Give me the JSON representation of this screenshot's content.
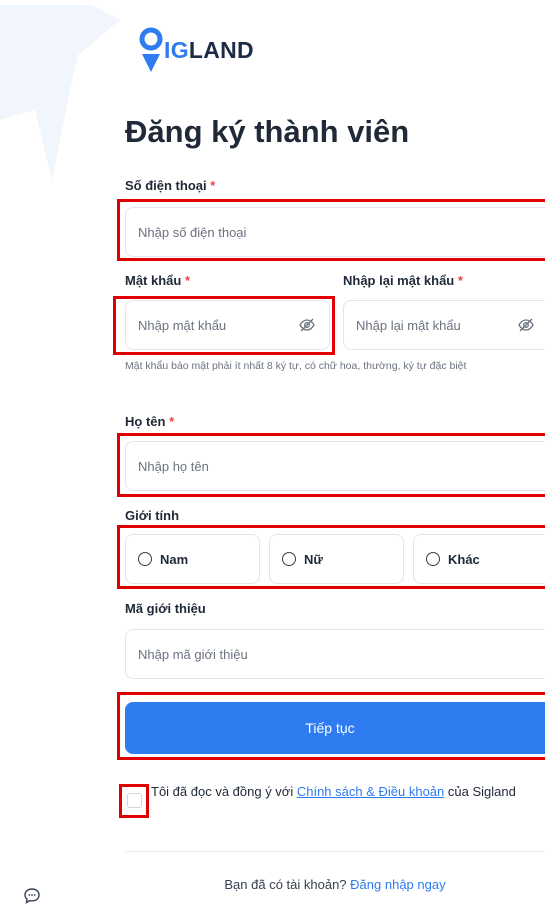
{
  "brand": {
    "logo_prefix": "IG",
    "logo_suffix": "LAND"
  },
  "page_title": "Đăng ký thành viên",
  "phone": {
    "label": "Số điện thoại",
    "required_mark": "*",
    "placeholder": "Nhập số điện thoại"
  },
  "password": {
    "label": "Mật khẩu",
    "required_mark": "*",
    "placeholder": "Nhập mật khẩu"
  },
  "confirm_password": {
    "label": "Nhập lại mật khẩu",
    "required_mark": "*",
    "placeholder": "Nhập lại mật khẩu"
  },
  "password_hint": "Mật khẩu bảo mật phải ít nhất 8 ký tự, có chữ hoa, thường, ký tự đặc biệt",
  "fullname": {
    "label": "Họ tên",
    "required_mark": "*",
    "placeholder": "Nhập họ tên"
  },
  "gender": {
    "label": "Giới tính",
    "options": [
      "Nam",
      "Nữ",
      "Khác"
    ]
  },
  "referral": {
    "label": "Mã giới thiệu",
    "placeholder": "Nhập mã giới thiệu"
  },
  "submit_label": "Tiếp tục",
  "terms": {
    "prefix": "Tôi đã đọc và đồng ý với",
    "link": "Chính sách & Điều khoản",
    "suffix": "của Sigland"
  },
  "footer": {
    "question": "Bạn đã có tài khoản?",
    "login_link": "Đăng nhập ngay"
  },
  "colors": {
    "brand_blue": "#2f7bf0",
    "highlight_red": "#e00000",
    "required_red": "#ef4444"
  },
  "icons": {
    "password_toggle": "eye-off-icon",
    "chat": "chat-bubble-icon"
  }
}
